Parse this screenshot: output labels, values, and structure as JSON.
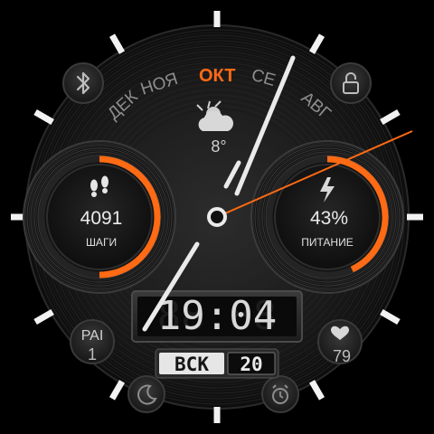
{
  "months": {
    "previous_2": "ДЕК",
    "previous_1": "НОЯ",
    "current": "ОКТ",
    "next_1": "СЕ",
    "next_2": "АВГ"
  },
  "weather": {
    "temperature": "8°",
    "icon": "partly-cloudy-icon"
  },
  "steps": {
    "value": "4091",
    "label": "ШАГИ",
    "progress": 0.5,
    "icon": "footprints-icon"
  },
  "battery": {
    "value": "43%",
    "label": "ПИТАНИЕ",
    "progress": 0.43,
    "icon": "lightning-icon"
  },
  "time": {
    "text": "19:04",
    "ghost": "88:88"
  },
  "date": {
    "weekday": "ВСК",
    "day": "20"
  },
  "pai": {
    "label": "PAI",
    "value": "1"
  },
  "heart": {
    "value": "79",
    "icon": "heart-icon"
  },
  "corner_icons": [
    "bluetooth-icon",
    "lock-icon",
    "moon-icon",
    "alarm-icon"
  ],
  "colors": {
    "accent": "#ff6a14",
    "text": "#e6e6e6",
    "muted": "#9a9a9a",
    "background": "#000000"
  }
}
